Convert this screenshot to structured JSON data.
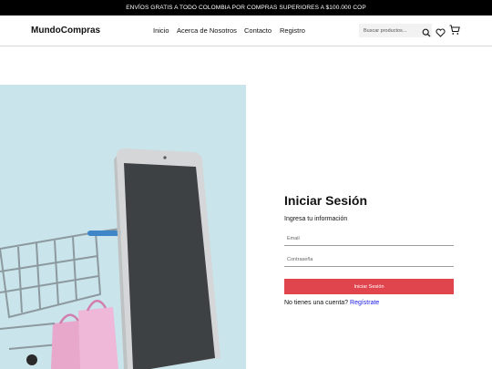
{
  "announcement": "ENVÍOS GRATIS A TODO COLOMBIA POR COMPRAS SUPERIORES A $100.000 COP",
  "header": {
    "logo": "MundoCompras",
    "nav": [
      "Inicio",
      "Acerca de Nosotros",
      "Contacto",
      "Registro"
    ],
    "search_placeholder": "Buscar productos..."
  },
  "icons": {
    "search": "search-icon",
    "wishlist": "heart-icon",
    "cart": "cart-icon"
  },
  "login": {
    "title": "Iniciar Sesión",
    "subtitle": "Ingresa tu información",
    "email_placeholder": "Email",
    "password_placeholder": "Contraseña",
    "submit_label": "Iniciar Sesión",
    "no_account_text": "No tienes una cuenta?",
    "register_link": "Regístrate"
  },
  "colors": {
    "accent": "#e0454e",
    "link": "#1a1ae6",
    "hero_bg": "#c9e4ea"
  }
}
